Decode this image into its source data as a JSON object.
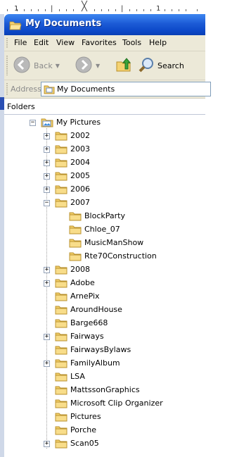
{
  "window": {
    "title": "My Documents"
  },
  "menu": [
    "File",
    "Edit",
    "View",
    "Favorites",
    "Tools",
    "Help"
  ],
  "toolbar": {
    "back_label": "Back",
    "search_label": "Search"
  },
  "address": {
    "label": "Address",
    "value": "My Documents"
  },
  "folders_pane": {
    "title": "Folders"
  },
  "tree": [
    {
      "label": "My Pictures",
      "level": 0,
      "expander": "minus",
      "icon": "pictures-folder-icon"
    },
    {
      "label": "2002",
      "level": 1,
      "expander": "plus",
      "icon": "folder-icon"
    },
    {
      "label": "2003",
      "level": 1,
      "expander": "plus",
      "icon": "folder-icon"
    },
    {
      "label": "2004",
      "level": 1,
      "expander": "plus",
      "icon": "folder-icon"
    },
    {
      "label": "2005",
      "level": 1,
      "expander": "plus",
      "icon": "folder-icon"
    },
    {
      "label": "2006",
      "level": 1,
      "expander": "plus",
      "icon": "folder-icon"
    },
    {
      "label": "2007",
      "level": 1,
      "expander": "minus",
      "icon": "folder-icon"
    },
    {
      "label": "BlockParty",
      "level": 2,
      "expander": "none",
      "icon": "folder-icon"
    },
    {
      "label": "Chloe_07",
      "level": 2,
      "expander": "none",
      "icon": "folder-icon"
    },
    {
      "label": "MusicManShow",
      "level": 2,
      "expander": "none",
      "icon": "folder-icon"
    },
    {
      "label": "Rte70Construction",
      "level": 2,
      "expander": "none",
      "icon": "folder-icon"
    },
    {
      "label": "2008",
      "level": 1,
      "expander": "plus",
      "icon": "folder-icon"
    },
    {
      "label": "Adobe",
      "level": 1,
      "expander": "plus",
      "icon": "folder-icon"
    },
    {
      "label": "ArnePix",
      "level": 1,
      "expander": "none",
      "icon": "folder-icon"
    },
    {
      "label": "AroundHouse",
      "level": 1,
      "expander": "none",
      "icon": "folder-icon"
    },
    {
      "label": "Barge668",
      "level": 1,
      "expander": "none",
      "icon": "folder-icon"
    },
    {
      "label": "Fairways",
      "level": 1,
      "expander": "plus",
      "icon": "folder-icon"
    },
    {
      "label": "FairwaysBylaws",
      "level": 1,
      "expander": "none",
      "icon": "folder-icon"
    },
    {
      "label": "FamilyAlbum",
      "level": 1,
      "expander": "plus",
      "icon": "folder-icon"
    },
    {
      "label": "LSA",
      "level": 1,
      "expander": "none",
      "icon": "folder-icon"
    },
    {
      "label": "MattssonGraphics",
      "level": 1,
      "expander": "none",
      "icon": "folder-icon"
    },
    {
      "label": "Microsoft Clip Organizer",
      "level": 1,
      "expander": "none",
      "icon": "folder-icon"
    },
    {
      "label": "Pictures",
      "level": 1,
      "expander": "none",
      "icon": "folder-icon"
    },
    {
      "label": "Porche",
      "level": 1,
      "expander": "none",
      "icon": "folder-icon"
    },
    {
      "label": "Scan05",
      "level": 1,
      "expander": "plus",
      "icon": "folder-icon"
    }
  ],
  "colors": {
    "titlebar": "#0c48c8",
    "chrome": "#ece9d8",
    "folder": "#f3cf6a"
  }
}
